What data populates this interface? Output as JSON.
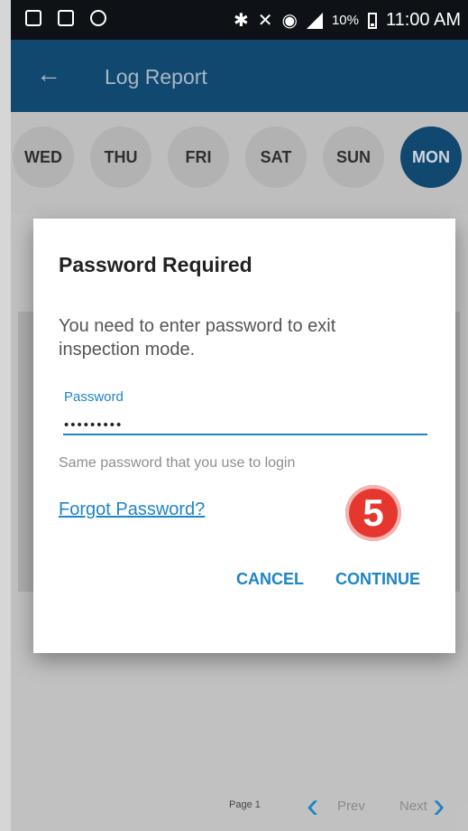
{
  "status_bar": {
    "battery_percent": "10%",
    "time": "11:00 AM"
  },
  "app_bar": {
    "title": "Log Report",
    "back_icon": "back-arrow-icon"
  },
  "day_tabs": [
    {
      "label": "WED",
      "selected": false
    },
    {
      "label": "THU",
      "selected": false
    },
    {
      "label": "FRI",
      "selected": false
    },
    {
      "label": "SAT",
      "selected": false
    },
    {
      "label": "SUN",
      "selected": false
    },
    {
      "label": "MON",
      "selected": true
    }
  ],
  "dialog": {
    "title": "Password Required",
    "message": "You need to enter password to exit inspection mode.",
    "field": {
      "label": "Password",
      "value": "•••••••••"
    },
    "hint": "Same password that you use to login",
    "forgot_link": "Forgot Password?",
    "step_badge": "5",
    "cancel_label": "CANCEL",
    "continue_label": "CONTINUE"
  },
  "pagination": {
    "page": "Page 1",
    "prev": "Prev",
    "next": "Next"
  },
  "colors": {
    "primary": "#134f7a",
    "accent": "#1d84c6",
    "badge": "#e6372f"
  }
}
